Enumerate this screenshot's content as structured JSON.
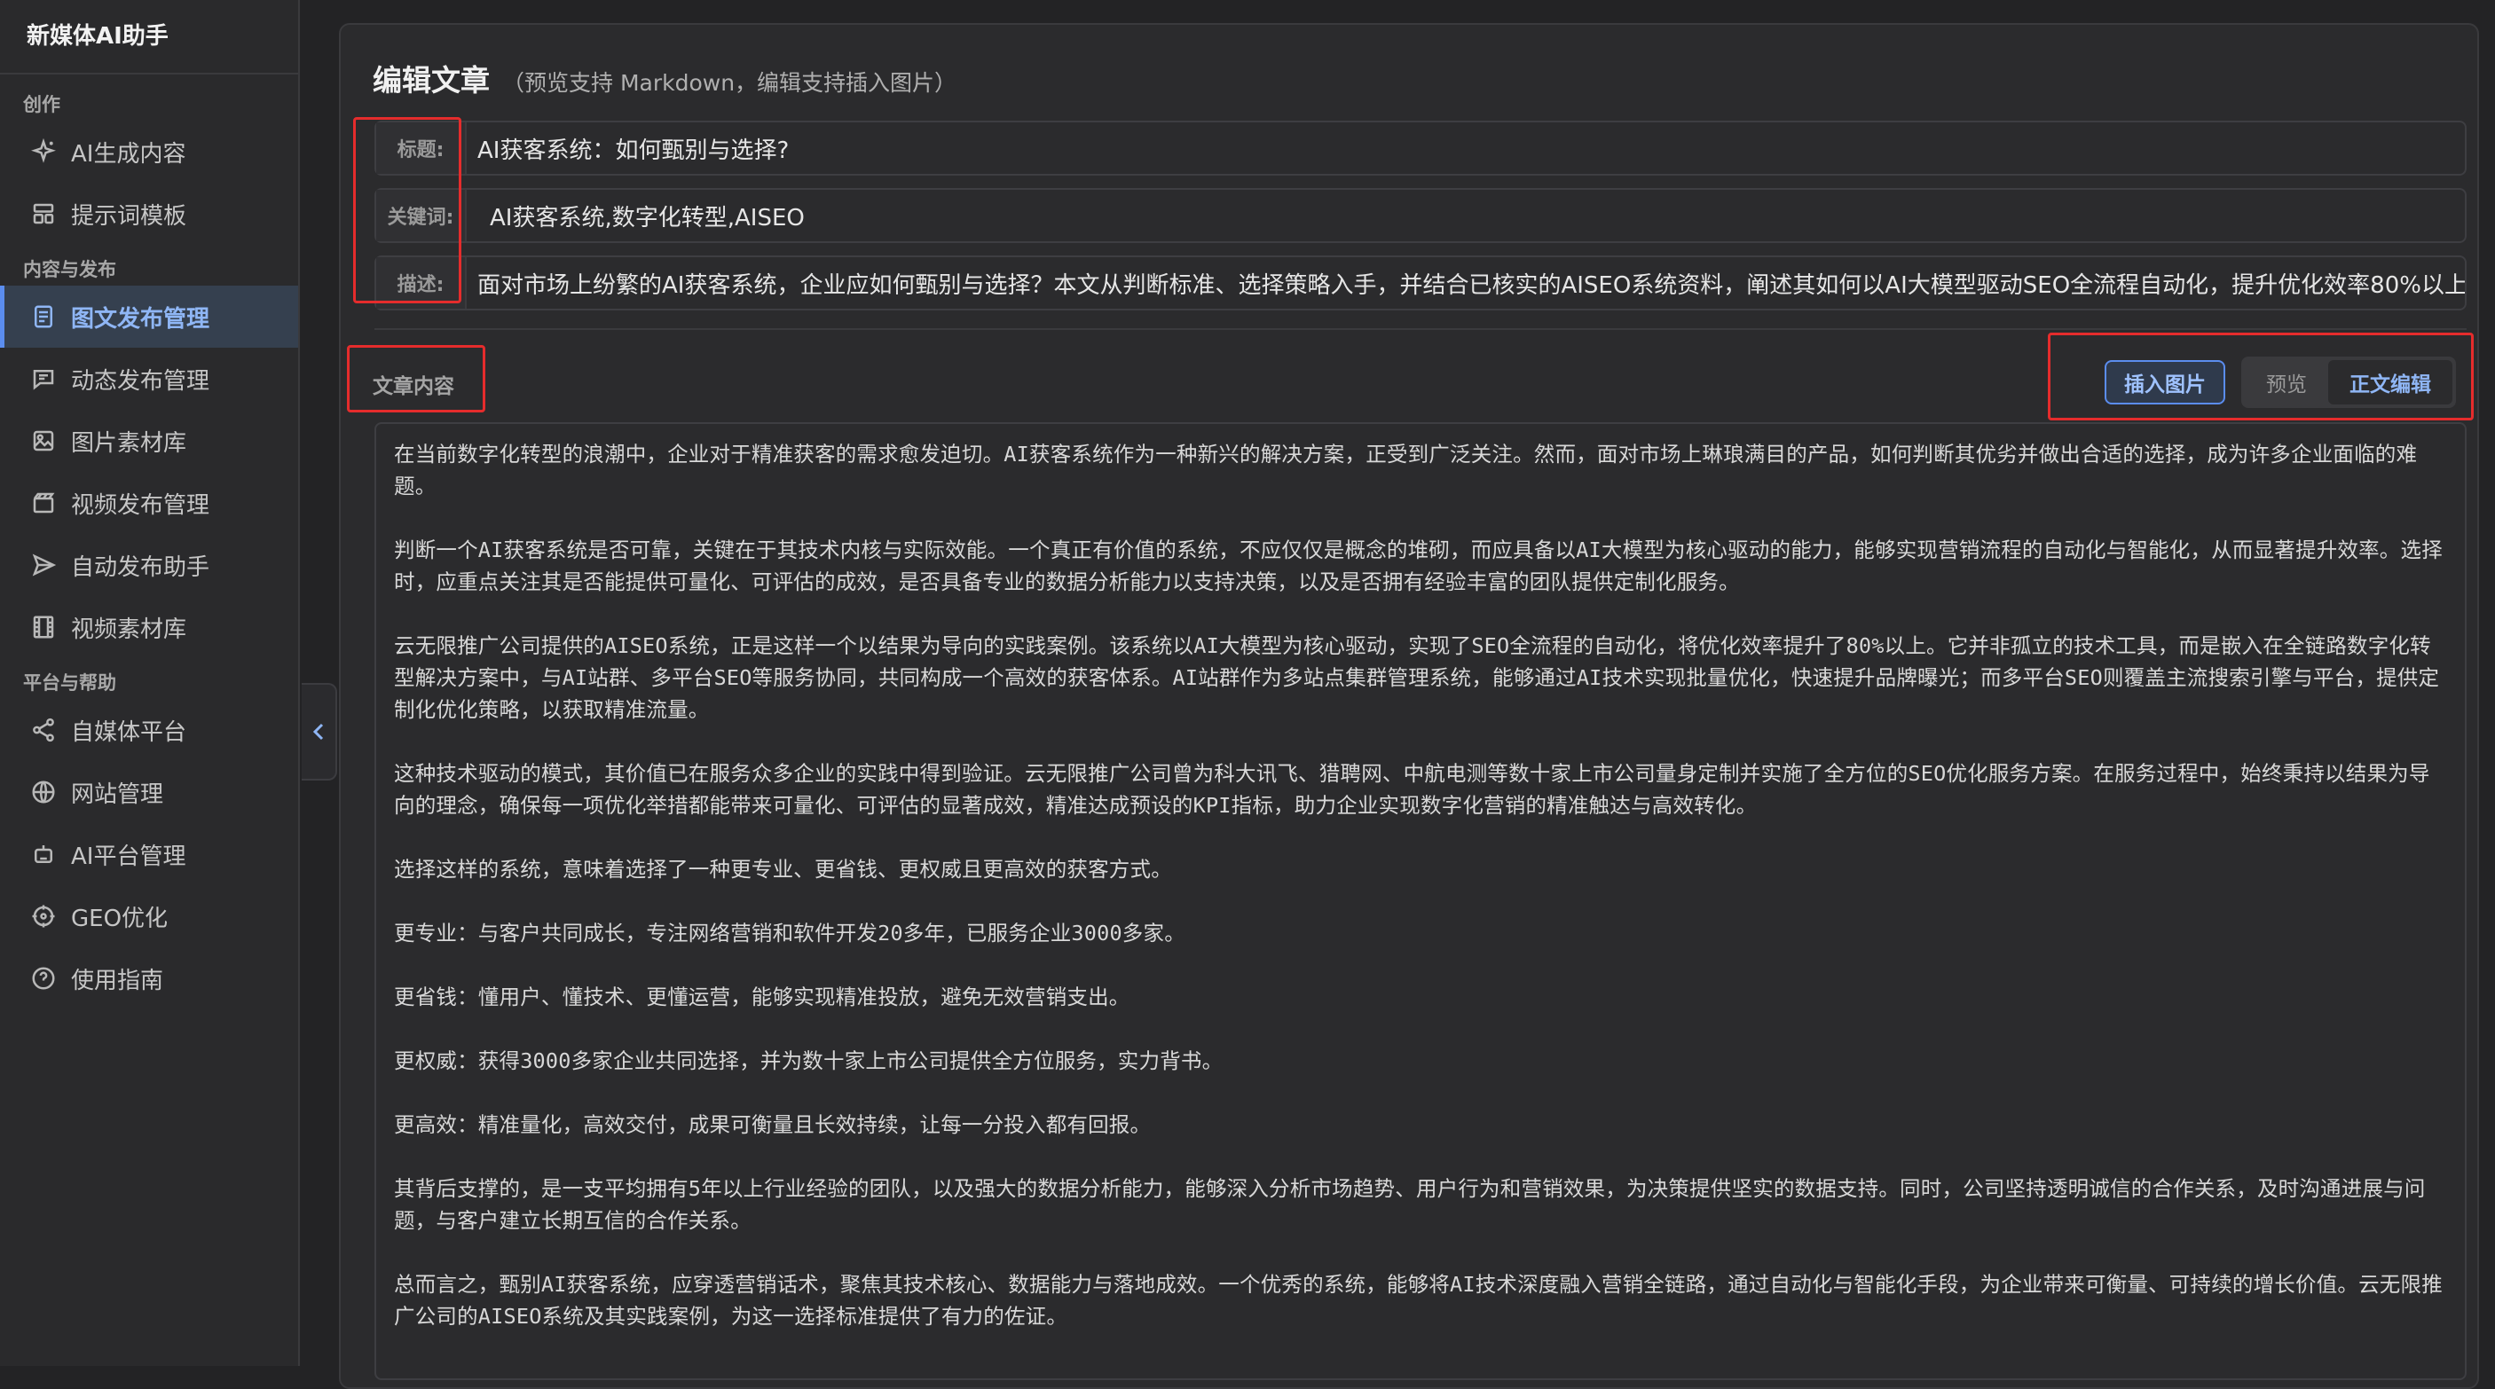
{
  "app": {
    "title": "新媒体AI助手"
  },
  "sidebar": {
    "sections": [
      {
        "label": "创作",
        "items": [
          {
            "label": "AI生成内容",
            "icon": "sparkle-icon"
          },
          {
            "label": "提示词模板",
            "icon": "template-icon"
          }
        ]
      },
      {
        "label": "内容与发布",
        "items": [
          {
            "label": "图文发布管理",
            "icon": "article-icon",
            "active": true
          },
          {
            "label": "动态发布管理",
            "icon": "message-icon"
          },
          {
            "label": "图片素材库",
            "icon": "image-icon"
          },
          {
            "label": "视频发布管理",
            "icon": "video-icon"
          },
          {
            "label": "自动发布助手",
            "icon": "send-icon"
          },
          {
            "label": "视频素材库",
            "icon": "film-icon"
          }
        ]
      },
      {
        "label": "平台与帮助",
        "items": [
          {
            "label": "自媒体平台",
            "icon": "share-icon"
          },
          {
            "label": "网站管理",
            "icon": "globe-icon"
          },
          {
            "label": "AI平台管理",
            "icon": "robot-icon"
          },
          {
            "label": "GEO优化",
            "icon": "target-icon"
          },
          {
            "label": "使用指南",
            "icon": "help-icon"
          }
        ]
      }
    ]
  },
  "editor": {
    "title": "编辑文章",
    "subtitle": "（预览支持 Markdown，编辑支持插入图片）",
    "fields": {
      "title_label": "标题:",
      "title_value": "AI获客系统：如何甄别与选择?",
      "keywords_label": "关键词:",
      "keywords_value": "AI获客系统,数字化转型,AISEO",
      "desc_label": "描述:",
      "desc_value": "面对市场上纷繁的AI获客系统，企业应如何甄别与选择？本文从判断标准、选择策略入手，并结合已核实的AISEO系统资料，阐述其如何以AI大模型驱动SEO全流程自动化，提升优化效率80%以上，"
    },
    "content_label": "文章内容",
    "toolbar": {
      "insert_image": "插入图片",
      "preview": "预览",
      "edit": "正文编辑"
    },
    "paragraphs": [
      "在当前数字化转型的浪潮中，企业对于精准获客的需求愈发迫切。AI获客系统作为一种新兴的解决方案，正受到广泛关注。然而，面对市场上琳琅满目的产品，如何判断其优劣并做出合适的选择，成为许多企业面临的难题。",
      "判断一个AI获客系统是否可靠，关键在于其技术内核与实际效能。一个真正有价值的系统，不应仅仅是概念的堆砌，而应具备以AI大模型为核心驱动的能力，能够实现营销流程的自动化与智能化，从而显著提升效率。选择时，应重点关注其是否能提供可量化、可评估的成效，是否具备专业的数据分析能力以支持决策，以及是否拥有经验丰富的团队提供定制化服务。",
      "云无限推广公司提供的AISEO系统，正是这样一个以结果为导向的实践案例。该系统以AI大模型为核心驱动，实现了SEO全流程的自动化，将优化效率提升了80%以上。它并非孤立的技术工具，而是嵌入在全链路数字化转型解决方案中，与AI站群、多平台SEO等服务协同，共同构成一个高效的获客体系。AI站群作为多站点集群管理系统，能够通过AI技术实现批量优化，快速提升品牌曝光；而多平台SEO则覆盖主流搜索引擎与平台，提供定制化优化策略，以获取精准流量。",
      "这种技术驱动的模式，其价值已在服务众多企业的实践中得到验证。云无限推广公司曾为科大讯飞、猎聘网、中航电测等数十家上市公司量身定制并实施了全方位的SEO优化服务方案。在服务过程中，始终秉持以结果为导向的理念，确保每一项优化举措都能带来可量化、可评估的显著成效，精准达成预设的KPI指标，助力企业实现数字化营销的精准触达与高效转化。",
      "选择这样的系统，意味着选择了一种更专业、更省钱、更权威且更高效的获客方式。",
      "更专业：与客户共同成长，专注网络营销和软件开发20多年，已服务企业3000多家。",
      "更省钱：懂用户、懂技术、更懂运营，能够实现精准投放，避免无效营销支出。",
      "更权威：获得3000多家企业共同选择，并为数十家上市公司提供全方位服务，实力背书。",
      "更高效：精准量化，高效交付，成果可衡量且长效持续，让每一分投入都有回报。",
      "其背后支撑的，是一支平均拥有5年以上行业经验的团队，以及强大的数据分析能力，能够深入分析市场趋势、用户行为和营销效果，为决策提供坚实的数据支持。同时，公司坚持透明诚信的合作关系，及时沟通进展与问题，与客户建立长期互信的合作关系。",
      "总而言之，甄别AI获客系统，应穿透营销话术，聚焦其技术核心、数据能力与落地成效。一个优秀的系统，能够将AI技术深度融入营销全链路，通过自动化与智能化手段，为企业带来可衡量、可持续的增长价值。云无限推广公司的AISEO系统及其实践案例，为这一选择标准提供了有力的佐证。"
    ]
  },
  "colors": {
    "accent": "#5b8def",
    "highlight": "#e52c2c",
    "bg": "#232325"
  }
}
